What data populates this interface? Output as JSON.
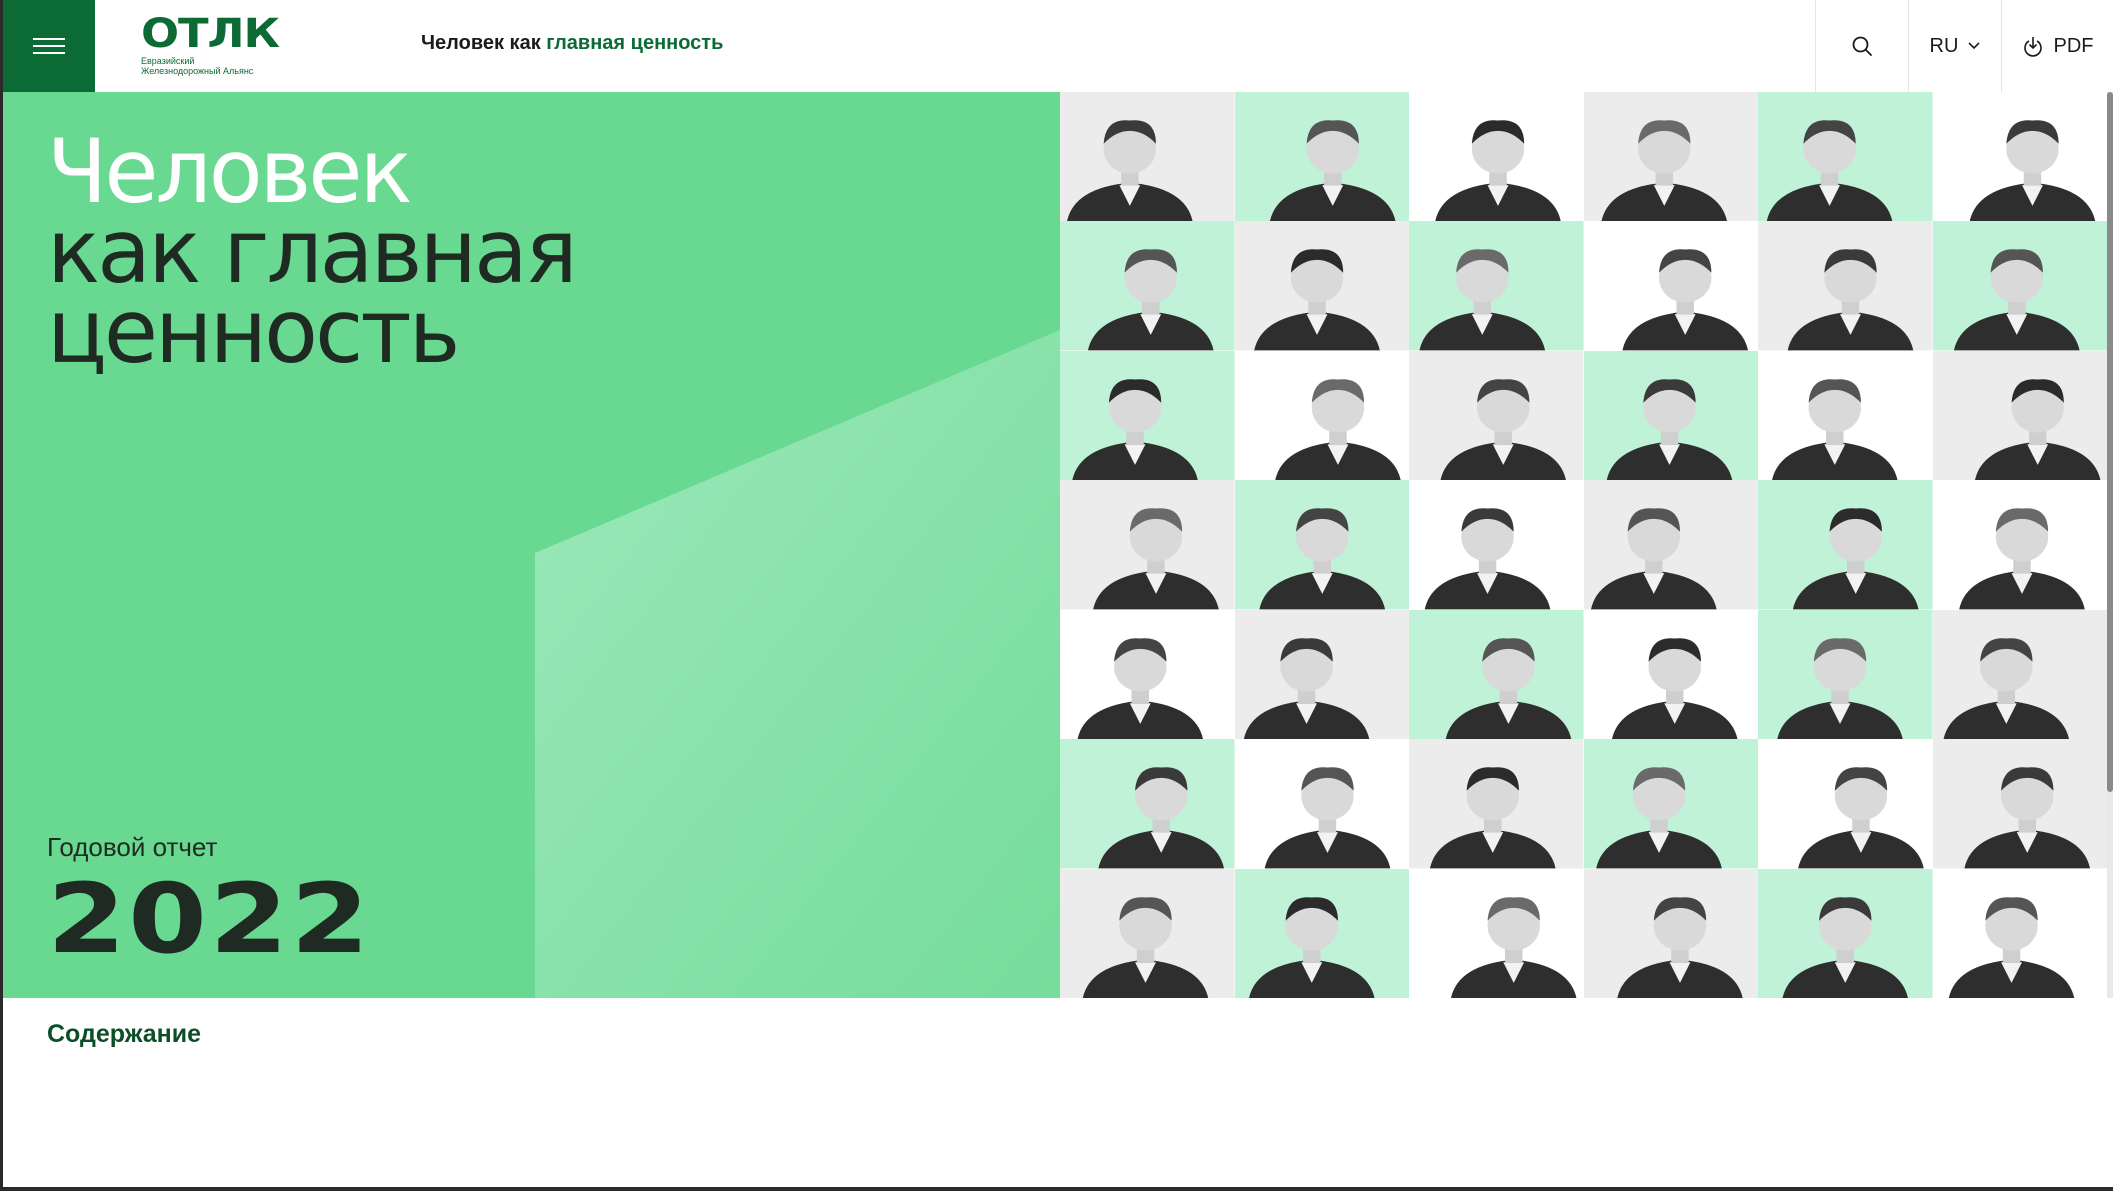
{
  "header": {
    "menu_icon": "hamburger-icon",
    "logo": {
      "word": "ОТЛК",
      "line1": "Евразийский",
      "line2": "Железнодорожный Альянс"
    },
    "title_plain": "Человек как ",
    "title_accent": "главная ценность",
    "search_icon": "search-icon",
    "language": "RU",
    "language_icon": "chevron-down-icon",
    "pdf_label": "PDF",
    "pdf_icon": "download-icon"
  },
  "hero": {
    "title_line1": "Человек",
    "title_line2": "как главная",
    "title_line3": "ценность",
    "report_label": "Годовой отчет",
    "year": "2022"
  },
  "contents_link": "Содержание",
  "portrait_grid": {
    "columns": 6,
    "rows": 7,
    "cells": [
      "gray",
      "mint",
      "white",
      "gray",
      "mint",
      "white",
      "mint",
      "gray",
      "mint",
      "white",
      "gray",
      "mint",
      "mint",
      "white",
      "gray",
      "mint",
      "white",
      "gray",
      "gray",
      "mint",
      "white",
      "gray",
      "mint",
      "white",
      "white",
      "gray",
      "mint",
      "white",
      "mint",
      "gray",
      "mint",
      "white",
      "gray",
      "mint",
      "white",
      "gray",
      "gray",
      "mint",
      "white",
      "gray",
      "mint",
      "white"
    ]
  },
  "colors": {
    "brand_green": "#0c6b34",
    "hero_green": "#69d891",
    "mint": "#bff2d6",
    "gray": "#ececec",
    "white": "#ffffff"
  }
}
